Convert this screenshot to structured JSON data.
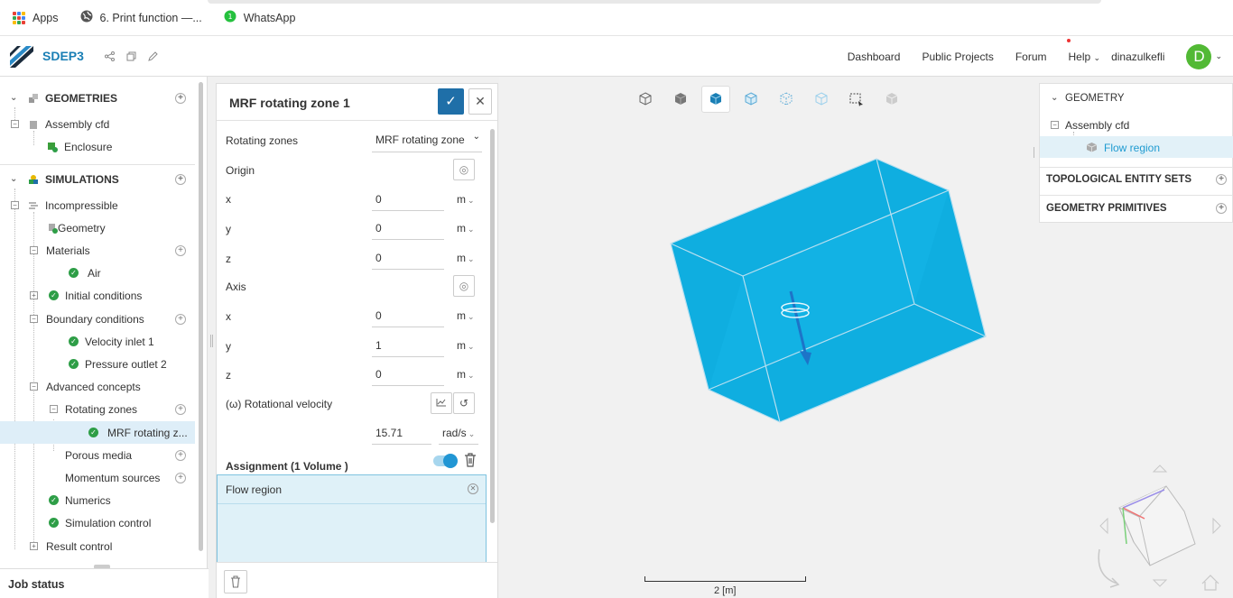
{
  "bookmarks": {
    "items": [
      {
        "label": "Apps",
        "icon": "apps-grid-icon"
      },
      {
        "label": "6. Print function —...",
        "icon": "globe-icon"
      },
      {
        "label": "WhatsApp",
        "icon": "whatsapp-icon"
      }
    ]
  },
  "header": {
    "brand": "SDEP3",
    "nav": [
      "Dashboard",
      "Public Projects",
      "Forum",
      "Help"
    ],
    "user": "dinazulkefli",
    "avatar_letter": "D"
  },
  "tree": {
    "geometries_title": "GEOMETRIES",
    "assembly": "Assembly cfd",
    "enclosure": "Enclosure",
    "simulations_title": "SIMULATIONS",
    "incompressible": "Incompressible",
    "geometry": "Geometry",
    "materials": "Materials",
    "air": "Air",
    "initial_conditions": "Initial conditions",
    "boundary_conditions": "Boundary conditions",
    "velocity_inlet": "Velocity inlet 1",
    "pressure_outlet": "Pressure outlet 2",
    "advanced_concepts": "Advanced concepts",
    "rotating_zones": "Rotating zones",
    "mrf_item": "MRF rotating z...",
    "porous_media": "Porous media",
    "momentum_sources": "Momentum sources",
    "numerics": "Numerics",
    "simulation_control": "Simulation control",
    "result_control": "Result control"
  },
  "job_status": "Job status",
  "panel": {
    "title": "MRF rotating zone 1",
    "rotating_zones_label": "Rotating zones",
    "rotating_zones_value": "MRF rotating zone",
    "origin_label": "Origin",
    "origin": {
      "x": "0",
      "y": "0",
      "z": "0"
    },
    "axis_label": "Axis",
    "axis": {
      "x": "0",
      "y": "1",
      "z": "0"
    },
    "length_unit": "m",
    "x_label": "x",
    "y_label": "y",
    "z_label": "z",
    "rot_velocity_label": "(ω) Rotational velocity",
    "rot_velocity_value": "15.71",
    "rot_velocity_unit": "rad/s",
    "assignment_label": "Assignment (1 Volume )",
    "assigned_item": "Flow region"
  },
  "viewport": {
    "scale_label": "2 [m]",
    "colors": {
      "box": "#0faee0",
      "edge": "#b8dff0"
    }
  },
  "right_panel": {
    "geometry_title": "GEOMETRY",
    "assembly": "Assembly cfd",
    "flow_region": "Flow region",
    "topological": "TOPOLOGICAL ENTITY SETS",
    "primitives": "GEOMETRY PRIMITIVES"
  }
}
